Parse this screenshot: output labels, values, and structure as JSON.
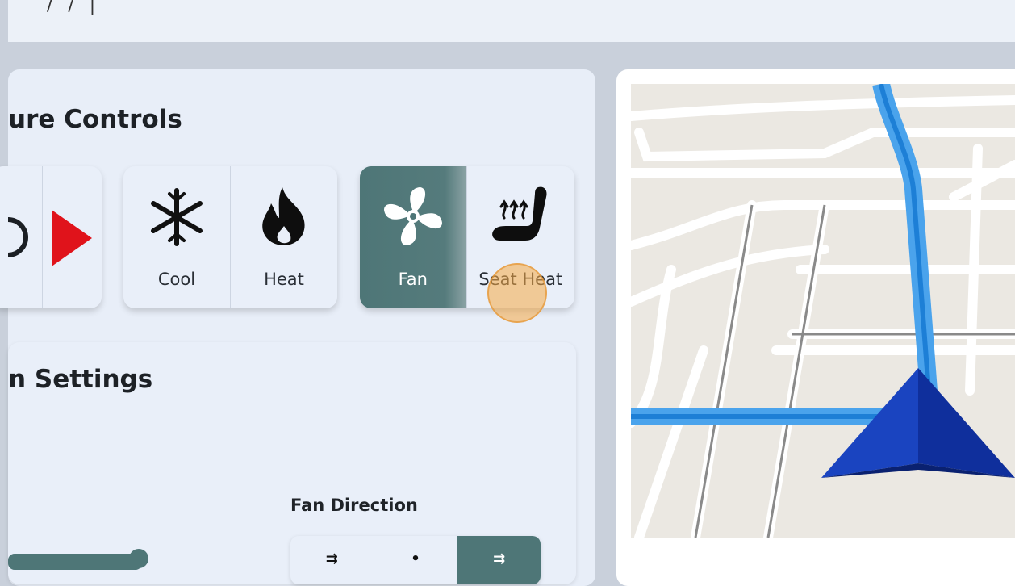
{
  "header": {
    "partial_text": "/ / |"
  },
  "climate": {
    "title": "ure Controls",
    "groups": [
      {
        "items": [
          {
            "icon": "power-icon"
          },
          {
            "icon": "play-arrow-icon"
          }
        ]
      },
      {
        "items": [
          {
            "icon": "snowflake-icon",
            "label": "Cool"
          },
          {
            "icon": "flame-icon",
            "label": "Heat"
          }
        ]
      },
      {
        "items": [
          {
            "icon": "fan-icon",
            "label": "Fan",
            "active": true
          },
          {
            "icon": "seat-heat-icon",
            "label": "Seat Heat"
          }
        ]
      }
    ],
    "active_color": "#4e7677",
    "play_color": "#e0131b"
  },
  "settings": {
    "title": "n Settings",
    "fan_direction": {
      "label": "Fan Direction",
      "options": [
        {
          "icon": "airflow-up-icon"
        },
        {
          "icon": "airflow-mid-icon"
        },
        {
          "icon": "airflow-down-icon",
          "active": true
        }
      ]
    }
  },
  "map": {
    "route_color": "#4aa3ec",
    "arrow_color": "#1a44c0"
  }
}
